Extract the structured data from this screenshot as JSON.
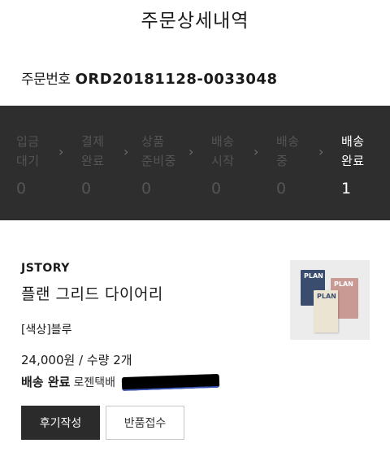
{
  "page": {
    "title": "주문상세내역"
  },
  "order": {
    "number_label": "주문번호",
    "number_value": "ORD20181128-0033048"
  },
  "status_steps": [
    {
      "label": "입금 대기",
      "count": "0",
      "active": false
    },
    {
      "label": "결제 완료",
      "count": "0",
      "active": false
    },
    {
      "label": "상품 준비중",
      "count": "0",
      "active": false
    },
    {
      "label": "배송 시작",
      "count": "0",
      "active": false
    },
    {
      "label": "배송 중",
      "count": "0",
      "active": false
    },
    {
      "label": "배송 완료",
      "count": "1",
      "active": true
    }
  ],
  "status_chevron": "›",
  "product": {
    "brand": "JSTORY",
    "name": "플랜 그리드 다이어리",
    "option": "[색상]블루",
    "price_qty": "24,000원 / 수량 2개",
    "shipping_status": "배송 완료",
    "carrier": "로젠택배",
    "image": {
      "alt": "PLAN 다이어리 3권 (네이비, 핑크, 크림)",
      "book_title": "PLAN",
      "colors": {
        "navy": "#3b4d6e",
        "pink": "#c99a93",
        "cream": "#ece4d3",
        "background": "#ececec"
      }
    }
  },
  "buttons": {
    "review": "후기작성",
    "return": "반품접수"
  },
  "colors": {
    "status_bar_bg": "#2e2e2e",
    "inactive_step": "#545454",
    "active_step": "#ffffff",
    "primary_button": "#2b2b2b"
  }
}
